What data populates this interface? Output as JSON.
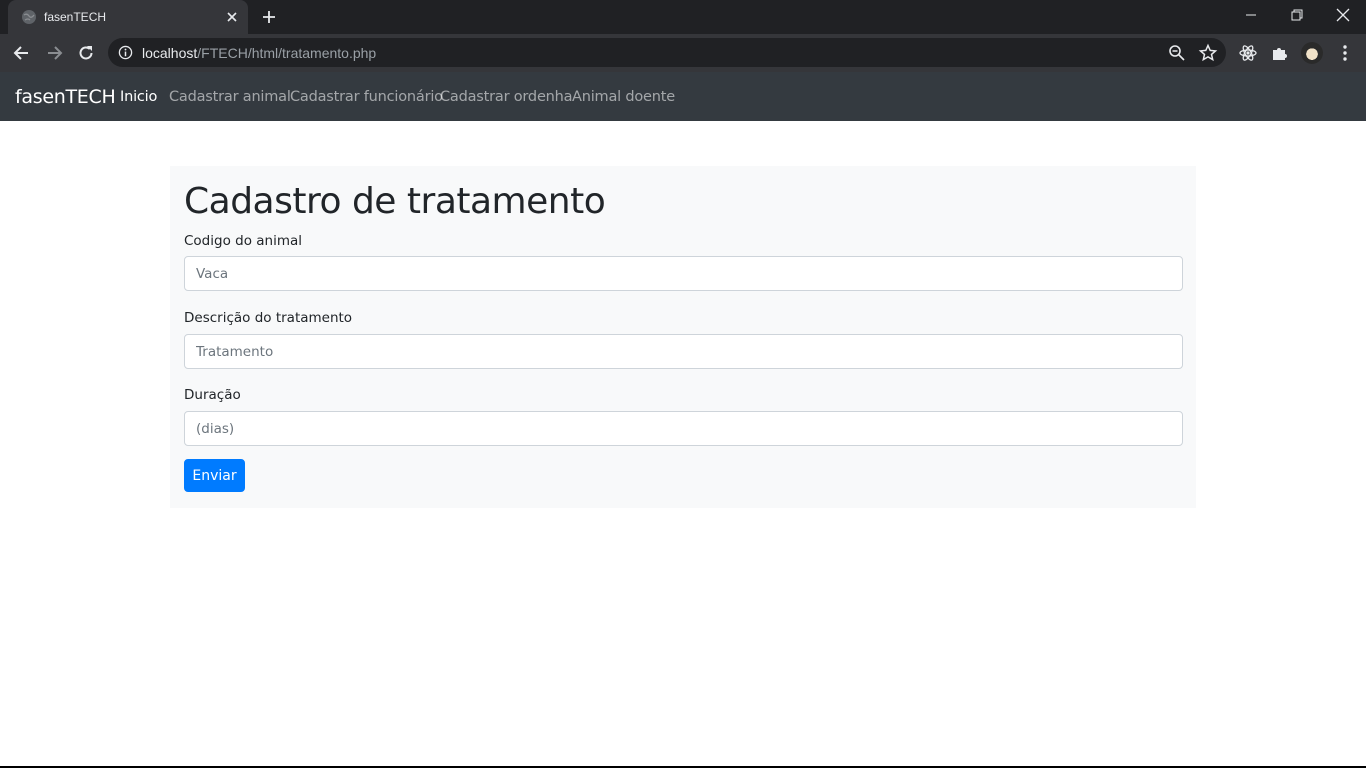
{
  "browser": {
    "tab_title": "fasenTECH",
    "url_host": "localhost",
    "url_path": "/FTECH/html/tratamento.php"
  },
  "navbar": {
    "brand": "fasenTECH",
    "links": [
      {
        "label": "Inicio",
        "active": true
      },
      {
        "label": "Cadastrar animal"
      },
      {
        "label": "Cadastrar funcionário"
      },
      {
        "label": "Cadastrar ordenha"
      },
      {
        "label": "Animal doente"
      }
    ]
  },
  "form": {
    "title": "Cadastro de tratamento",
    "fields": [
      {
        "label": "Codigo do animal",
        "placeholder": "Vaca",
        "value": ""
      },
      {
        "label": "Descrição do tratamento",
        "placeholder": "Tratamento",
        "value": ""
      },
      {
        "label": "Duração",
        "placeholder": "(dias)",
        "value": ""
      }
    ],
    "submit_label": "Enviar"
  },
  "colors": {
    "navbar_bg": "#343a40",
    "primary": "#007bff",
    "panel_bg": "#f8f9fa"
  }
}
